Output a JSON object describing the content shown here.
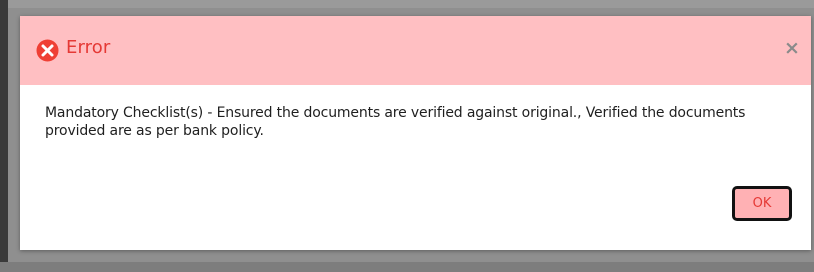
{
  "dialog": {
    "title": "Error",
    "close_label": "×",
    "message": "Mandatory Checklist(s) - Ensured the documents are verified against original., Verified the documents provided are as per bank policy.",
    "ok_label": "OK"
  },
  "icons": {
    "error": "error-circle-x-icon",
    "close": "close-icon"
  },
  "colors": {
    "header_background": "#ffbfc2",
    "title_text": "#e53935",
    "error_icon": "#ef3f34",
    "ok_button_background": "#ffb1b4",
    "ok_button_text": "#e53935"
  }
}
